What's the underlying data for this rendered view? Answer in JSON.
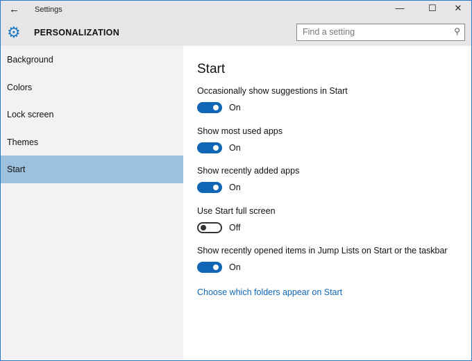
{
  "window": {
    "title": "Settings",
    "back": "←",
    "minimize": "—",
    "maximize": "☐",
    "close": "✕"
  },
  "header": {
    "title": "PERSONALIZATION",
    "search_placeholder": "Find a setting"
  },
  "sidebar": {
    "items": [
      {
        "label": "Background"
      },
      {
        "label": "Colors"
      },
      {
        "label": "Lock screen"
      },
      {
        "label": "Themes"
      },
      {
        "label": "Start",
        "selected": true
      }
    ]
  },
  "main": {
    "title": "Start",
    "settings": [
      {
        "label": "Occasionally show suggestions in Start",
        "state": "On",
        "on": true
      },
      {
        "label": "Show most used apps",
        "state": "On",
        "on": true
      },
      {
        "label": "Show recently added apps",
        "state": "On",
        "on": true
      },
      {
        "label": "Use Start full screen",
        "state": "Off",
        "on": false
      },
      {
        "label": "Show recently opened items in Jump Lists on Start or the taskbar",
        "state": "On",
        "on": true
      }
    ],
    "link": "Choose which folders appear on Start"
  },
  "colors": {
    "accent": "#1066b4",
    "selected": "#9dc0de"
  }
}
